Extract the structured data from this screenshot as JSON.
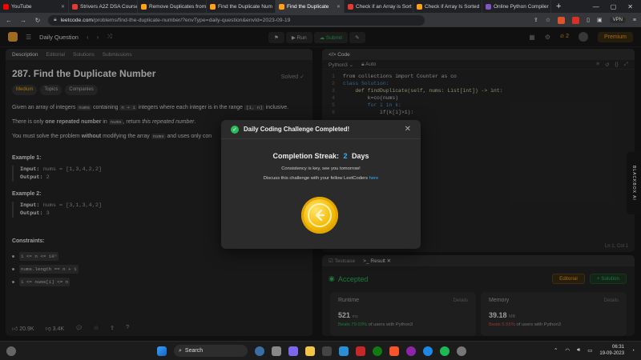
{
  "browser": {
    "tabs": [
      {
        "title": "YouTube",
        "color": "#ff0000",
        "active": false
      },
      {
        "title": "Strivers A2Z DSA Course",
        "color": "#e53935",
        "active": false
      },
      {
        "title": "Remove Duplicates from",
        "color": "#ffa116",
        "active": false
      },
      {
        "title": "Find the Duplicate Num",
        "color": "#ffa116",
        "active": false
      },
      {
        "title": "Find the Duplicate",
        "color": "#ffa116",
        "active": true
      },
      {
        "title": "Check if an Array is Sort",
        "color": "#e53935",
        "active": false
      },
      {
        "title": "Check if Array Is Sorted",
        "color": "#ffa116",
        "active": false
      },
      {
        "title": "Online Python Compiler",
        "color": "#7e57c2",
        "active": false
      }
    ],
    "url_domain": "leetcode.com",
    "url_path": "/problems/find-the-duplicate-number/?envType=daily-question&envId=2023-09-19",
    "vpn": "VPN",
    "new_tab": "+"
  },
  "lcnav": {
    "section": "Daily Question",
    "run": "Run",
    "submit": "Submit",
    "streak": "2",
    "premium": "Premium"
  },
  "description": {
    "tabs": [
      "Description",
      "Editorial",
      "Solutions",
      "Submissions"
    ],
    "title": "287. Find the Duplicate Number",
    "solved": "Solved",
    "difficulty": "Medium",
    "topics": "Topics",
    "companies": "Companies",
    "p1_a": "Given an array of integers",
    "p1_code1": "nums",
    "p1_b": "containing",
    "p1_code2": "n + 1",
    "p1_c": "integers where each integer is in the range",
    "p1_code3": "[1, n]",
    "p1_d": "inclusive.",
    "p2_a": "There is only",
    "p2_b": "one repeated number",
    "p2_c": "in",
    "p2_code": "nums",
    "p2_d": ", return",
    "p2_e": "this repeated number",
    "p3_a": "You must solve the problem",
    "p3_b": "without",
    "p3_c": "modifying the array",
    "p3_code": "nums",
    "p3_d": "and uses only con",
    "ex1_title": "Example 1:",
    "ex1_input_label": "Input:",
    "ex1_input": "nums = [1,3,4,2,2]",
    "ex1_output_label": "Output:",
    "ex1_output": "2",
    "ex2_title": "Example 2:",
    "ex2_input_label": "Input:",
    "ex2_input": "nums = [3,1,3,4,2]",
    "ex2_output_label": "Output:",
    "ex2_output": "3",
    "constraints_title": "Constraints:",
    "constraints": [
      "1 <= n <= 10⁵",
      "nums.length == n + 1",
      "1 <= nums[i] <= n"
    ],
    "likes": "20.9K",
    "dislikes": "3.4K"
  },
  "code": {
    "title": "Code",
    "language": "Python3",
    "auto": "Auto",
    "lines": [
      {
        "n": "1",
        "text": "from collections import Counter as co"
      },
      {
        "n": "2",
        "text": "class Solution:"
      },
      {
        "n": "3",
        "text": "    def findDuplicate(self, nums: List[int]) -> int:"
      },
      {
        "n": "4",
        "text": "        k=co(nums)"
      },
      {
        "n": "5",
        "text": "        for i in k:"
      },
      {
        "n": "6",
        "text": "            if(k[i]>1):"
      }
    ],
    "cursor": "Ln 1, Col 1"
  },
  "result": {
    "tab_testcase": "Testcase",
    "tab_result": "Result",
    "status": "Accepted",
    "editorial": "Editorial",
    "solution": "+ Solution",
    "runtime_label": "Runtime",
    "runtime_value": "521",
    "runtime_unit": "ms",
    "runtime_beats": "Beats 79.03%",
    "runtime_suffix": "of users with Python3",
    "memory_label": "Memory",
    "memory_value": "39.18",
    "memory_unit": "MB",
    "memory_beats": "Beats 5.55%",
    "memory_suffix": "of users with Python3",
    "details": "Details"
  },
  "modal": {
    "title": "Daily Coding Challenge Completed!",
    "streak_label": "Completion Streak:",
    "streak_num": "2",
    "streak_unit": "Days",
    "sub1": "Consistency is key, see you tomorrow!",
    "sub2": "Discuss this challenge with your fellow LeetCoders",
    "link": "here"
  },
  "sidetab": "BLACKBOX AI",
  "taskbar": {
    "search": "Search",
    "time": "06:31",
    "date": "19-09-2023",
    "lang": "ENG IN"
  }
}
